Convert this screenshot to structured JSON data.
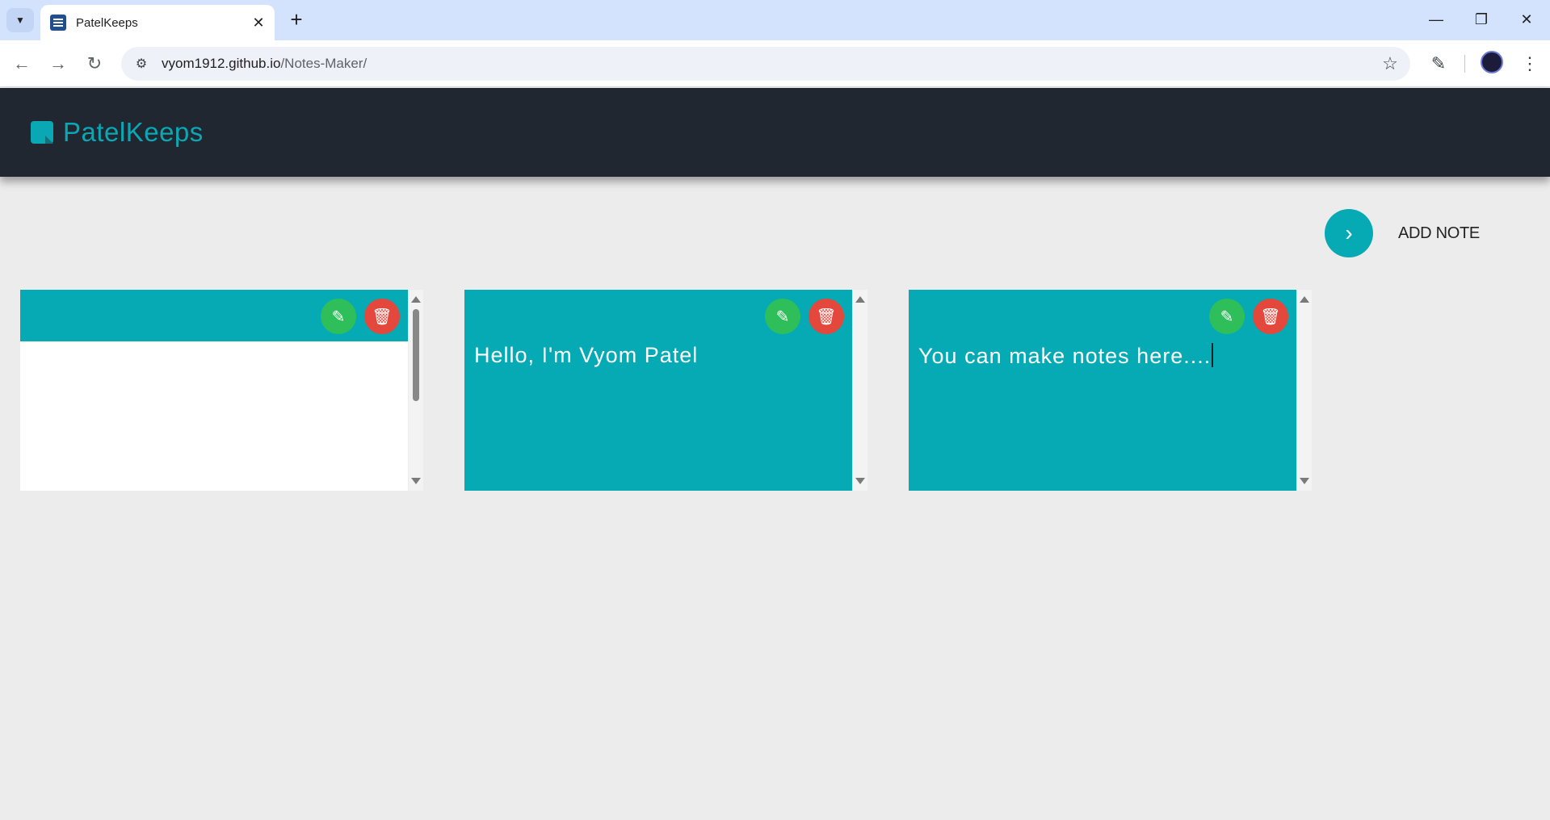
{
  "browser": {
    "tab_title": "PatelKeeps",
    "url_host": "vyom1912.github.io",
    "url_path": "/Notes-Maker/"
  },
  "app": {
    "brand": "PatelKeeps",
    "add_note_label": "ADD NOTE"
  },
  "notes": [
    {
      "text": "",
      "scrollbar": true
    },
    {
      "text": "Hello, I'm Vyom Patel"
    },
    {
      "text": "You can make notes here...."
    }
  ],
  "colors": {
    "header_bg": "#212731",
    "accent": "#06aab4",
    "edit": "#2ebf5b",
    "delete": "#e4473b"
  }
}
